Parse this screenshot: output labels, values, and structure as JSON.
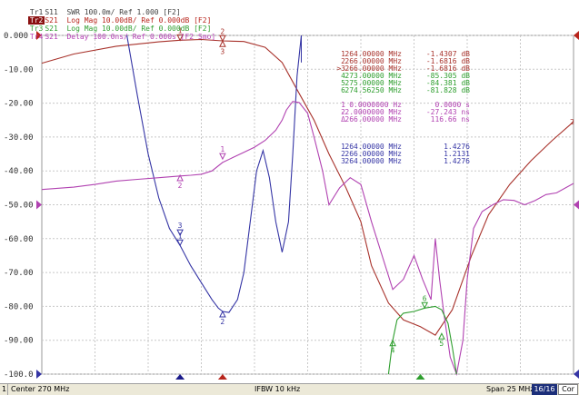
{
  "traces_header": [
    {
      "id": "Tr1",
      "text": "S11  SWR 100.0m/ Ref 1.000 [F2]",
      "color": "#404040",
      "active": false
    },
    {
      "id": "Tr2",
      "text": "S21  Log Mag 10.00dB/ Ref 0.000dB [F2]",
      "color": "#b8251c",
      "active": true
    },
    {
      "id": "Tr3",
      "text": "S21  Log Mag 10.00dB/ Ref 0.000dB [F2]",
      "color": "#2e9e2e",
      "active": false
    },
    {
      "id": "Tr4",
      "text": "S21  Delay 100.0ns/ Ref 0.000s [F2 Smo]",
      "color": "#b53fb5",
      "active": false
    }
  ],
  "colors": {
    "trace_red": "#a8322b",
    "trace_blue": "#3535a5",
    "trace_purple": "#b142b1",
    "trace_green": "#2e9e2e",
    "grid": "#c8c8c8"
  },
  "chart_data": {
    "type": "line",
    "xlabel": "",
    "ylabel": "",
    "xlim": [
      257.5,
      282.5
    ],
    "ylim": [
      -100,
      0
    ],
    "y_tick_labels": [
      "0.000",
      "-10.00",
      "-20.00",
      "-30.00",
      "-40.00",
      "-50.00",
      "-60.00",
      "-70.00",
      "-80.00",
      "-90.00",
      "-100.0"
    ],
    "grid": true,
    "series": [
      {
        "id": "Tr2",
        "color": "#a8322b",
        "x": [
          257.5,
          259,
          261,
          263,
          264,
          265,
          266,
          267,
          268,
          268.8,
          269.5,
          270.3,
          271,
          271.8,
          272.5,
          273,
          273.8,
          274.5,
          275.3,
          276,
          276.8,
          277.7,
          278.5,
          279.5,
          280.5,
          281.5,
          282.5
        ],
        "y": [
          -8.2,
          -5.5,
          -3.2,
          -1.9,
          -1.43,
          -1.2,
          -1.62,
          -1.8,
          -3.5,
          -8,
          -16,
          -25,
          -35,
          -45,
          -55,
          -68,
          -79,
          -84,
          -86,
          -88.5,
          -81,
          -65,
          -53,
          -44,
          -37,
          -31,
          -25.5
        ]
      },
      {
        "id": "Tr1",
        "color": "#3535a5",
        "x": [
          261.5,
          262,
          262.5,
          263,
          263.5,
          264,
          264.5,
          265,
          265.5,
          265.8,
          266,
          266.3,
          266.7,
          267,
          267.3,
          267.6,
          267.9,
          268.2,
          268.5,
          268.8,
          269.1,
          269.3,
          269.5,
          269.7
        ],
        "y": [
          0,
          -18,
          -35,
          -48,
          -57,
          -62,
          -68,
          -73,
          -78,
          -80.5,
          -81.5,
          -81.8,
          -78,
          -70,
          -55,
          -40,
          -34,
          -42,
          -55,
          -64,
          -55,
          -35,
          -12,
          0
        ]
      },
      {
        "id": "Tr4",
        "color": "#b142b1",
        "x": [
          257.5,
          259,
          260,
          261,
          262,
          263,
          264,
          264.5,
          265,
          265.5,
          266,
          266.5,
          267,
          267.5,
          268,
          268.5,
          268.8,
          269,
          269.3,
          269.6,
          270,
          270.3,
          270.7,
          271,
          271.5,
          272,
          272.5,
          273,
          273.5,
          274,
          274.5,
          275,
          275.4,
          275.8,
          276,
          276.2,
          276.4,
          276.7,
          277,
          277.3,
          277.5,
          277.8,
          278.2,
          278.7,
          279.2,
          279.7,
          280.2,
          280.7,
          281.2,
          281.7,
          282.5
        ],
        "y": [
          -45.5,
          -44.8,
          -44,
          -43,
          -42.5,
          -42,
          -41.5,
          -41.3,
          -41,
          -40,
          -37.5,
          -36,
          -34.5,
          -33,
          -31,
          -28,
          -25,
          -22,
          -19.5,
          -19.8,
          -23,
          -30,
          -40,
          -50,
          -45,
          -42,
          -44,
          -55,
          -65,
          -75,
          -72,
          -65,
          -72,
          -78,
          -60,
          -72,
          -82,
          -95,
          -100,
          -90,
          -72,
          -57,
          -52,
          -50,
          -48.5,
          -48.7,
          -50,
          -48.7,
          -47,
          -46.5,
          -43.7
        ]
      },
      {
        "id": "Tr3",
        "color": "#2e9e2e",
        "x": [
          273.8,
          274,
          274.2,
          274.5,
          275,
          275.5,
          276,
          276.3,
          276.6,
          276.8,
          277
        ],
        "y": [
          -100,
          -90,
          -84,
          -82,
          -81.5,
          -80.5,
          -80,
          -81,
          -85,
          -92,
          -100
        ]
      }
    ],
    "bandwidth_marker_line_color": "#3535a5"
  },
  "marker_table": {
    "rows": [
      {
        "label": "1",
        "freq": "264.00000 MHz",
        "value": "-1.4307 dB",
        "color": "#a8322b"
      },
      {
        "label": "2",
        "freq": "266.00000 MHz",
        "value": "-1.6816 dB",
        "color": "#a8322b"
      },
      {
        "label": ">3",
        "freq": "266.00000 MHz",
        "value": "-1.6816 dB",
        "color": "#a8322b"
      },
      {
        "label": "4",
        "freq": "273.00000 MHz",
        "value": "-85.305 dB",
        "color": "#2e9e2e"
      },
      {
        "label": "5",
        "freq": "275.00000 MHz",
        "value": "-84.381 dB",
        "color": "#2e9e2e"
      },
      {
        "label": "6",
        "freq": "274.56250 MHz",
        "value": "-81.828 dB",
        "color": "#2e9e2e"
      },
      {
        "label": "1",
        "freq": "0.0000000 Hz",
        "value": "0.0000 s",
        "color": "#b142b1"
      },
      {
        "label": "2",
        "freq": "-2.0000000 MHz",
        "value": "-27.243 ns",
        "color": "#b142b1"
      },
      {
        "label": "Δ",
        "freq": "266.00000 MHz",
        "value": "116.66 ns",
        "color": "#b142b1"
      },
      {
        "label": "1",
        "freq": "264.00000 MHz",
        "value": "1.4276",
        "color": "#3535a5"
      },
      {
        "label": "2",
        "freq": "266.00000 MHz",
        "value": "1.2131",
        "color": "#3535a5"
      },
      {
        "label": "3",
        "freq": "264.00000 MHz",
        "value": "1.4276",
        "color": "#3535a5"
      }
    ]
  },
  "markers_on_plot": [
    {
      "label": "1",
      "x": 264,
      "y": -1.43,
      "color": "#a8322b",
      "dir": "down"
    },
    {
      "label": "2",
      "x": 266,
      "y": -1.68,
      "color": "#a8322b",
      "dir": "down"
    },
    {
      "label": "3",
      "x": 266,
      "y": -1.68,
      "color": "#a8322b",
      "dir": "up"
    },
    {
      "label": "1",
      "x": 266,
      "y": -36.5,
      "color": "#b142b1",
      "dir": "down"
    },
    {
      "label": "2",
      "x": 264,
      "y": -41.3,
      "color": "#b142b1",
      "dir": "up"
    },
    {
      "label": "1",
      "x": 264,
      "y": -62,
      "color": "#3535a5",
      "dir": "down"
    },
    {
      "label": "3",
      "x": 264,
      "y": -59,
      "color": "#3535a5",
      "dir": "down"
    },
    {
      "label": "2",
      "x": 266,
      "y": -81.5,
      "color": "#3535a5",
      "dir": "up"
    },
    {
      "label": "4",
      "x": 274,
      "y": -90,
      "color": "#2e9e2e",
      "dir": "up"
    },
    {
      "label": "5",
      "x": 276.3,
      "y": -88,
      "color": "#2e9e2e",
      "dir": "up"
    },
    {
      "label": "6",
      "x": 275.5,
      "y": -80.5,
      "color": "#2e9e2e",
      "dir": "down"
    }
  ],
  "right_edge_labels": [
    {
      "label": "2",
      "value": -25.5,
      "color": "#a8322b"
    }
  ],
  "reference_markers": [
    {
      "value": 0,
      "color": "#b8251c",
      "side": "left"
    },
    {
      "value": 0,
      "color": "#b8251c",
      "side": "right"
    },
    {
      "value": -50,
      "color": "#b142b1",
      "side": "left"
    },
    {
      "value": -50,
      "color": "#b142b1",
      "side": "right"
    },
    {
      "value": -100,
      "color": "#3535a5",
      "side": "left"
    },
    {
      "value": -100,
      "color": "#3535a5",
      "side": "right"
    }
  ],
  "bottom_markers": [
    {
      "x": 264,
      "color": "#1a1a8a"
    },
    {
      "x": 266,
      "color": "#b8251c"
    },
    {
      "x": 275.3,
      "color": "#2e9e2e"
    }
  ],
  "statusbar": {
    "channel": "1",
    "start": "Center 270 MHz",
    "ifbw": "IFBW 10 kHz",
    "span": "Span 25 MHz",
    "points": "16/16",
    "cor": "Cor"
  }
}
